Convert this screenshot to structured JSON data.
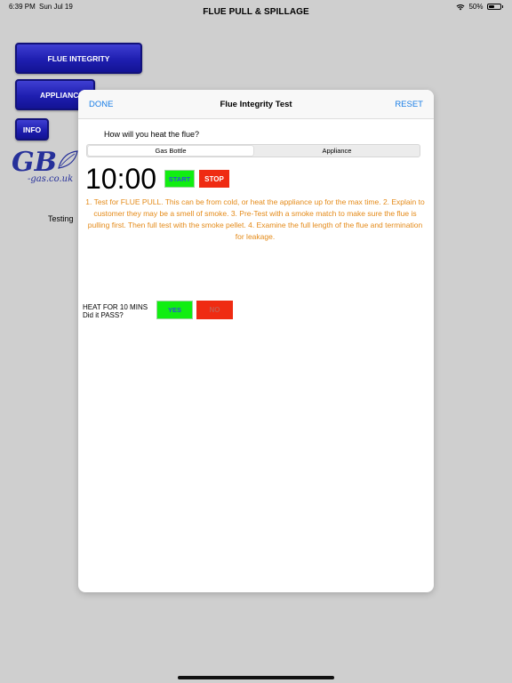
{
  "status_bar": {
    "time": "6:39 PM",
    "date": "Sun Jul 19",
    "battery_label": "50%",
    "battery_level": 0.5
  },
  "nav": {
    "title": "FLUE PULL & SPILLAGE"
  },
  "background": {
    "flue_integrity_button": "FLUE INTEGRITY",
    "appliance_button": "APPLIANCE",
    "info_button": "INFO",
    "logo_main": "GB",
    "logo_sub": "-gas.co.uk",
    "testing_text": "Testing"
  },
  "modal": {
    "done_label": "DONE",
    "title": "Flue Integrity Test",
    "reset_label": "RESET",
    "question": "How will you heat the flue?",
    "segments": [
      {
        "label": "Gas Bottle",
        "selected": true
      },
      {
        "label": "Appliance",
        "selected": false
      }
    ],
    "timer": "10:00",
    "start_label": "START",
    "stop_label": "STOP",
    "instructions": "1. Test for FLUE PULL.    This can be from cold, or heat the appliance up for the max time.           2. Explain to customer they may be a smell of smoke.   3.  Pre-Test with a smoke match to make sure the flue is pulling first. Then full test with the smoke pellet. 4. Examine the full length of the flue and termination for leakage.",
    "heat_line1": "HEAT FOR 10 MINS",
    "heat_line2": "Did it PASS?",
    "yes_label": "YES",
    "no_label": "NO"
  },
  "colors": {
    "accent_blue": "#1a7ee6",
    "button_blue": "#1e1eb0",
    "green": "#11ee11",
    "red": "#ef2b12",
    "instruction_orange": "#e48a18"
  }
}
